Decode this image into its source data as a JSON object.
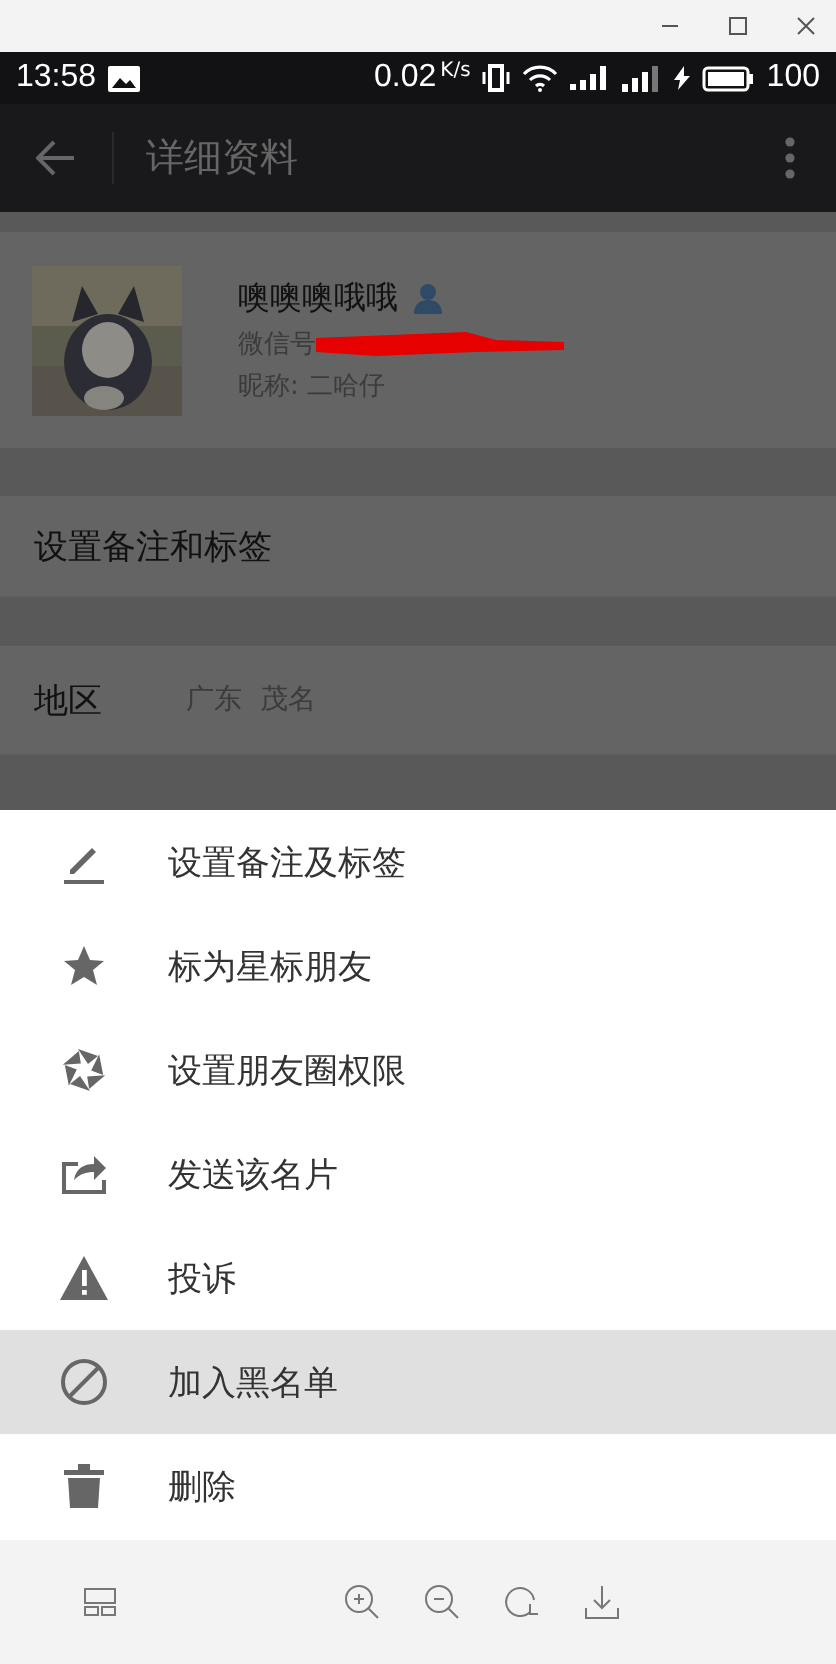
{
  "status_bar": {
    "time": "13:58",
    "speed": "0.02",
    "speed_unit": "K/s",
    "battery": "100"
  },
  "app_bar": {
    "title": "详细资料"
  },
  "profile": {
    "name": "噢噢噢哦哦",
    "wechat_id_label": "微信号",
    "nickname": "昵称: 二哈仔"
  },
  "remark_row": {
    "label": "设置备注和标签"
  },
  "region_row": {
    "label": "地区",
    "value": "广东  茂名"
  },
  "menu": [
    {
      "label": "设置备注及标签",
      "selected": false
    },
    {
      "label": "标为星标朋友",
      "selected": false
    },
    {
      "label": "设置朋友圈权限",
      "selected": false
    },
    {
      "label": "发送该名片",
      "selected": false
    },
    {
      "label": "投诉",
      "selected": false
    },
    {
      "label": "加入黑名单",
      "selected": true
    },
    {
      "label": "删除",
      "selected": false
    }
  ]
}
